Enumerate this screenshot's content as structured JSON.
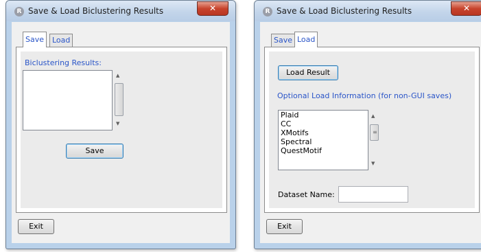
{
  "window_title": "Save & Load Biclustering Results",
  "close_glyph": "✕",
  "app_icon_letter": "R",
  "tabs": {
    "save": "Save",
    "load": "Load"
  },
  "save_tab": {
    "results_label": "Biclustering Results:",
    "save_button": "Save",
    "up_arrow": "▲",
    "down_arrow": "▼"
  },
  "load_tab": {
    "load_result_button": "Load Result",
    "optional_info_label": "Optional Load Information (for non-GUI saves)",
    "methods": [
      "Plaid",
      "CC",
      "XMotifs",
      "Spectral",
      "QuestMotif"
    ],
    "up_arrow": "▲",
    "down_arrow": "▼",
    "grip": "≡",
    "dataset_name_label": "Dataset Name:",
    "dataset_name_value": ""
  },
  "exit_button": "Exit",
  "colors": {
    "link_blue": "#2a55c8",
    "frame": "#b9d1ea",
    "close_red": "#c8442d",
    "panel_gray": "#ebebeb"
  },
  "icons": [
    "r-logo-icon",
    "close-icon",
    "scroll-up-arrow-icon",
    "scroll-down-arrow-icon"
  ]
}
